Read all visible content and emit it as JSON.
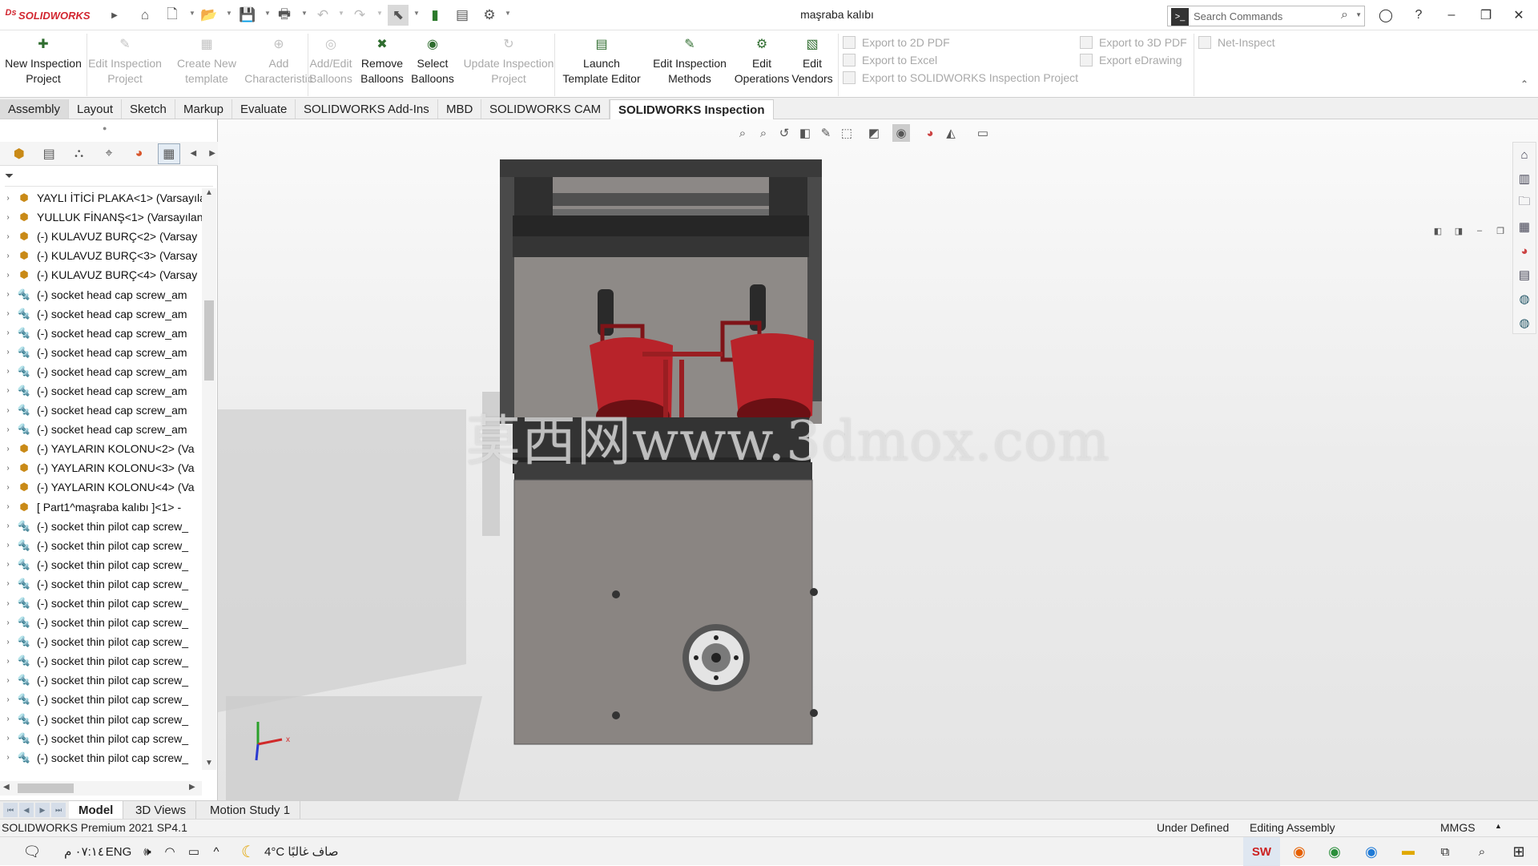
{
  "titlebar": {
    "brand": "SOLIDWORKS",
    "document_title": "maşraba kalıbı",
    "search_placeholder": "Search Commands"
  },
  "ribbon": {
    "buttons": [
      {
        "line1": "New Inspection",
        "line2": "Project",
        "enabled": true,
        "icon": "new-inspection-project-icon"
      },
      {
        "line1": "Edit Inspection",
        "line2": "Project",
        "enabled": false,
        "icon": "edit-inspection-project-icon"
      },
      {
        "line1": "Create New",
        "line2": "template",
        "enabled": false,
        "icon": "create-template-icon"
      },
      {
        "line1": "Add",
        "line2": "Characteristic",
        "enabled": false,
        "icon": "add-characteristic-icon"
      },
      {
        "line1": "Add/Edit",
        "line2": "Balloons",
        "enabled": false,
        "icon": "balloons-icon"
      },
      {
        "line1": "Remove",
        "line2": "Balloons",
        "enabled": true,
        "icon": "remove-balloons-icon"
      },
      {
        "line1": "Select",
        "line2": "Balloons",
        "enabled": true,
        "icon": "select-balloons-icon"
      },
      {
        "line1": "Update Inspection",
        "line2": "Project",
        "enabled": false,
        "icon": "update-project-icon"
      },
      {
        "line1": "Launch",
        "line2": "Template Editor",
        "enabled": true,
        "icon": "template-editor-icon"
      },
      {
        "line1": "Edit Inspection",
        "line2": "Methods",
        "enabled": true,
        "icon": "inspection-methods-icon"
      },
      {
        "line1": "Edit",
        "line2": "Operations",
        "enabled": true,
        "icon": "operations-icon"
      },
      {
        "line1": "Edit",
        "line2": "Vendors",
        "enabled": true,
        "icon": "vendors-icon"
      }
    ],
    "exports_col1": [
      "Export to 2D PDF",
      "Export to Excel",
      "Export to SOLIDWORKS Inspection Project"
    ],
    "exports_col2": [
      "Export to 3D PDF",
      "Export eDrawing"
    ],
    "net_inspect": "Net-Inspect"
  },
  "tabs": [
    "Assembly",
    "Layout",
    "Sketch",
    "Markup",
    "Evaluate",
    "SOLIDWORKS Add-Ins",
    "MBD",
    "SOLIDWORKS CAM",
    "SOLIDWORKS Inspection"
  ],
  "active_tab": "SOLIDWORKS Inspection",
  "tree": [
    {
      "label": "YAYLI İTİCİ PLAKA<1> (Varsayıla",
      "type": "assembly"
    },
    {
      "label": "YULLUK FİNANŞ<1> (Varsayılan",
      "type": "assembly"
    },
    {
      "label": "(-) KULAVUZ BURÇ<2> (Varsay",
      "type": "assembly"
    },
    {
      "label": "(-) KULAVUZ BURÇ<3> (Varsay",
      "type": "assembly"
    },
    {
      "label": "(-) KULAVUZ BURÇ<4> (Varsay",
      "type": "assembly"
    },
    {
      "label": "(-) socket head cap screw_am",
      "type": "part"
    },
    {
      "label": "(-) socket head cap screw_am",
      "type": "part"
    },
    {
      "label": "(-) socket head cap screw_am",
      "type": "part"
    },
    {
      "label": "(-) socket head cap screw_am",
      "type": "part"
    },
    {
      "label": "(-) socket head cap screw_am",
      "type": "part"
    },
    {
      "label": "(-) socket head cap screw_am",
      "type": "part"
    },
    {
      "label": "(-) socket head cap screw_am",
      "type": "part"
    },
    {
      "label": "(-) socket head cap screw_am",
      "type": "part"
    },
    {
      "label": "(-) YAYLARIN  KOLONU<2> (Va",
      "type": "assembly"
    },
    {
      "label": "(-) YAYLARIN  KOLONU<3> (Va",
      "type": "assembly"
    },
    {
      "label": "(-) YAYLARIN  KOLONU<4> (Va",
      "type": "assembly"
    },
    {
      "label": "[ Part1^maşraba kalıbı ]<1> -",
      "type": "assembly"
    },
    {
      "label": "(-) socket thin pilot cap screw_",
      "type": "part"
    },
    {
      "label": "(-) socket thin pilot cap screw_",
      "type": "part"
    },
    {
      "label": "(-) socket thin pilot cap screw_",
      "type": "part"
    },
    {
      "label": "(-) socket thin pilot cap screw_",
      "type": "part"
    },
    {
      "label": "(-) socket thin pilot cap screw_",
      "type": "part"
    },
    {
      "label": "(-) socket thin pilot cap screw_",
      "type": "part"
    },
    {
      "label": "(-) socket thin pilot cap screw_",
      "type": "part"
    },
    {
      "label": "(-) socket thin pilot cap screw_",
      "type": "part"
    },
    {
      "label": "(-) socket thin pilot cap screw_",
      "type": "part"
    },
    {
      "label": "(-) socket thin pilot cap screw_",
      "type": "part"
    },
    {
      "label": "(-) socket thin pilot cap screw_",
      "type": "part"
    },
    {
      "label": "(-) socket thin pilot cap screw_",
      "type": "part"
    },
    {
      "label": "(-) socket thin pilot cap screw_",
      "type": "part"
    },
    {
      "label": "(-) socket thin pilot cap screw",
      "type": "part"
    }
  ],
  "watermark": "莫西网www.3dmox.com",
  "bottom_tabs": [
    "Model",
    "3D Views",
    "Motion Study 1"
  ],
  "status": {
    "product": "SOLIDWORKS Premium 2021 SP4.1",
    "state": "Under Defined",
    "mode": "Editing Assembly",
    "units": "MMGS"
  },
  "taskbar": {
    "time": "٠٧:١٤ م",
    "lang": "ENG",
    "weather": "4°C صاف غالبًا"
  },
  "colors": {
    "accent": "#d22630",
    "cup": "#b8232a",
    "plate": "#8a8582",
    "frame": "#3a3a3a"
  }
}
